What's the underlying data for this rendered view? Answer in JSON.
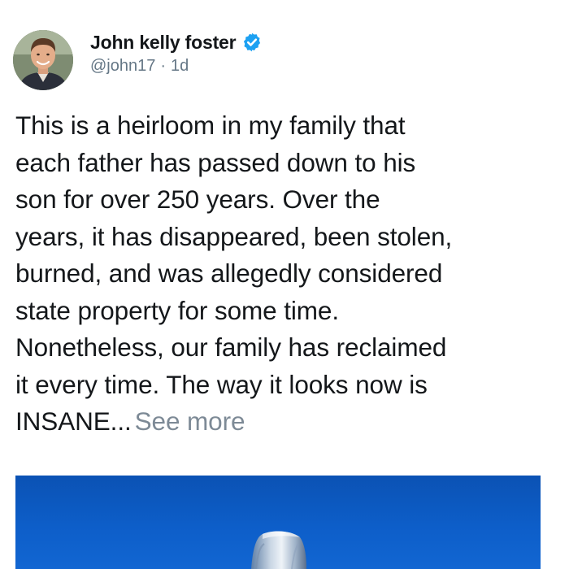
{
  "tweet": {
    "author": {
      "display_name": "John kelly foster",
      "handle": "@john17",
      "verified": true,
      "avatar_icon": "profile-photo"
    },
    "time_ago": "1d",
    "separator": "·",
    "text_lines": [
      "This is a heirloom in my family that",
      "each father has passed down to his",
      "son for over 250 years. Over the",
      "years, it has disappeared, been stolen,",
      "burned, and was allegedly considered",
      "state property for some time.",
      "Nonetheless, our family has reclaimed",
      "it every time. The way it looks now is",
      "INSANE..."
    ],
    "see_more_label": "See more",
    "media": {
      "description_icon": "photo-media",
      "background_color": "#0d5ec9"
    }
  },
  "colors": {
    "verified_badge": "#1da1f2",
    "secondary_text": "#657786",
    "see_more": "#7d8a96"
  }
}
